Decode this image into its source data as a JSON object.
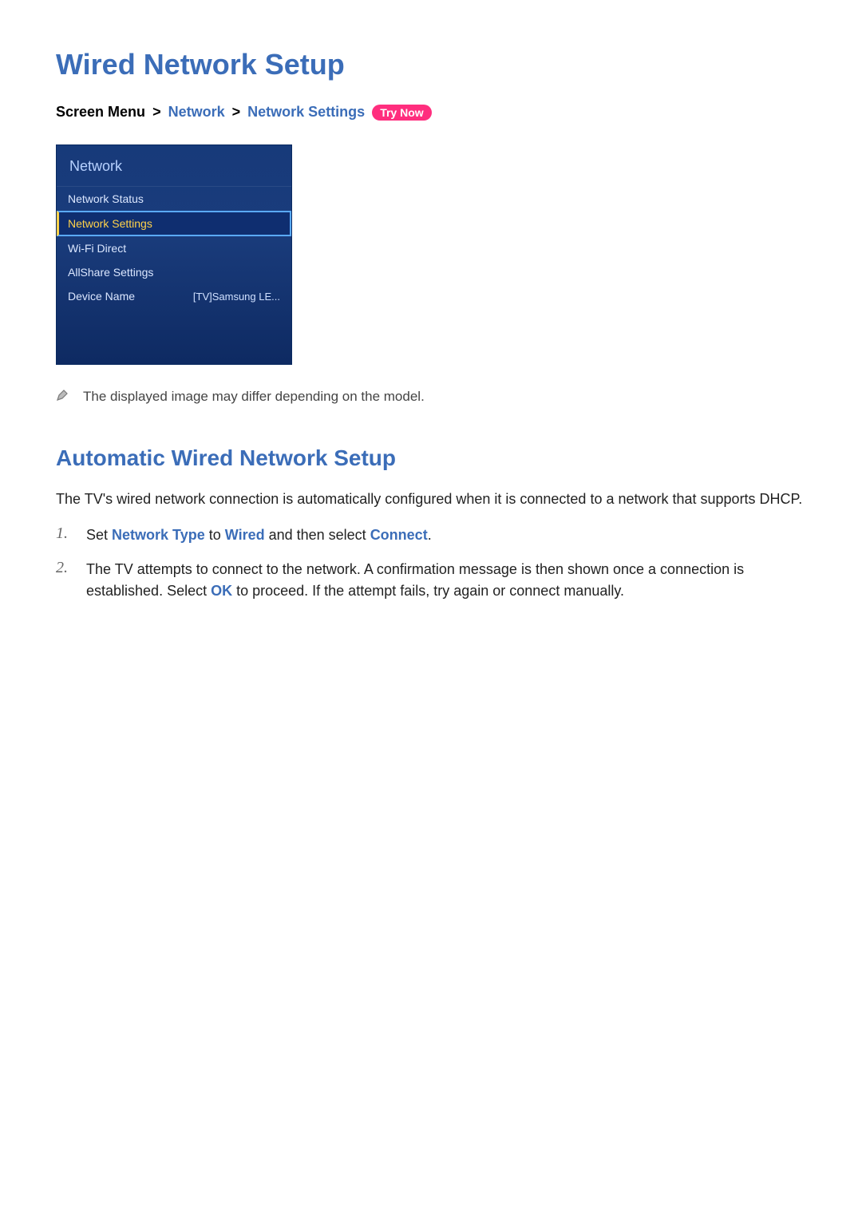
{
  "page": {
    "title": "Wired Network Setup",
    "breadcrumb": {
      "prefix": "Screen Menu",
      "sep": ">",
      "link1": "Network",
      "link2": "Network Settings",
      "badge": "Try Now"
    }
  },
  "menu": {
    "header": "Network",
    "items": [
      {
        "label": "Network Status",
        "value": "",
        "selected": false
      },
      {
        "label": "Network Settings",
        "value": "",
        "selected": true
      },
      {
        "label": "Wi-Fi Direct",
        "value": "",
        "selected": false
      },
      {
        "label": "AllShare Settings",
        "value": "",
        "selected": false
      },
      {
        "label": "Device Name",
        "value": "[TV]Samsung LE...",
        "selected": false
      }
    ]
  },
  "note": {
    "icon": "pencil-icon",
    "text": "The displayed image may differ depending on the model."
  },
  "section": {
    "title": "Automatic Wired Network Setup",
    "intro": "The TV's wired network connection is automatically configured when it is connected to a network that supports DHCP.",
    "steps": [
      {
        "num": "1.",
        "pre": "Set ",
        "kw1": "Network Type",
        "mid1": " to ",
        "kw2": "Wired",
        "mid2": " and then select ",
        "kw3": "Connect",
        "post": "."
      },
      {
        "num": "2.",
        "pre": "The TV attempts to connect to the network. A confirmation message is then shown once a connection is established. Select ",
        "kw1": "OK",
        "mid1": " to proceed. If the attempt fails, try again or connect manually.",
        "kw2": "",
        "mid2": "",
        "kw3": "",
        "post": ""
      }
    ]
  }
}
